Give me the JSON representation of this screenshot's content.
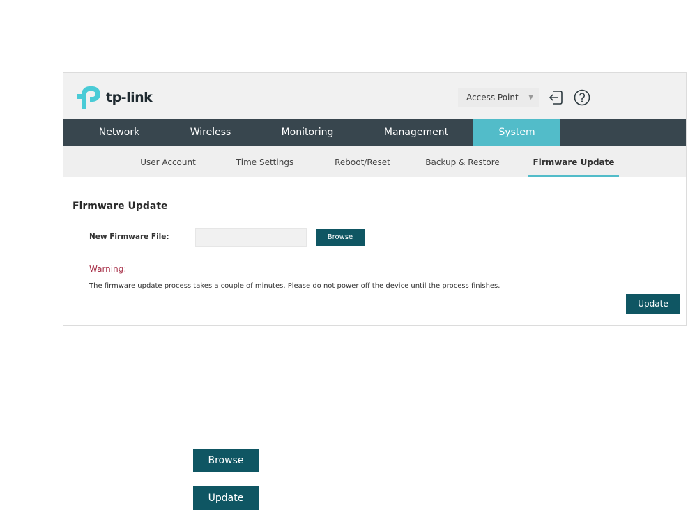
{
  "header": {
    "logo_text": "tp-link",
    "mode_select": {
      "value": "Access Point"
    },
    "icons": [
      "logout-icon",
      "help-icon"
    ]
  },
  "main_nav": {
    "items": [
      {
        "label": "Network"
      },
      {
        "label": "Wireless"
      },
      {
        "label": "Monitoring"
      },
      {
        "label": "Management"
      },
      {
        "label": "System",
        "active": true
      }
    ]
  },
  "sub_nav": {
    "items": [
      {
        "label": "User Account"
      },
      {
        "label": "Time Settings"
      },
      {
        "label": "Reboot/Reset"
      },
      {
        "label": "Backup & Restore"
      },
      {
        "label": "Firmware Update",
        "active": true
      }
    ]
  },
  "firmware": {
    "title": "Firmware Update",
    "field_label": "New Firmware File:",
    "file_value": "",
    "browse_label": "Browse",
    "warning_label": "Warning:",
    "warning_text": "The firmware update process takes a couple of minutes. Please do not power off the device until the process finishes.",
    "update_label": "Update"
  },
  "legend": {
    "browse_label": "Browse",
    "update_label": "Update"
  },
  "colors": {
    "brand": "#4acbd6",
    "nav_bg": "#38464e",
    "nav_active": "#52bcc9",
    "button": "#0f5663",
    "warning": "#a8324a"
  }
}
